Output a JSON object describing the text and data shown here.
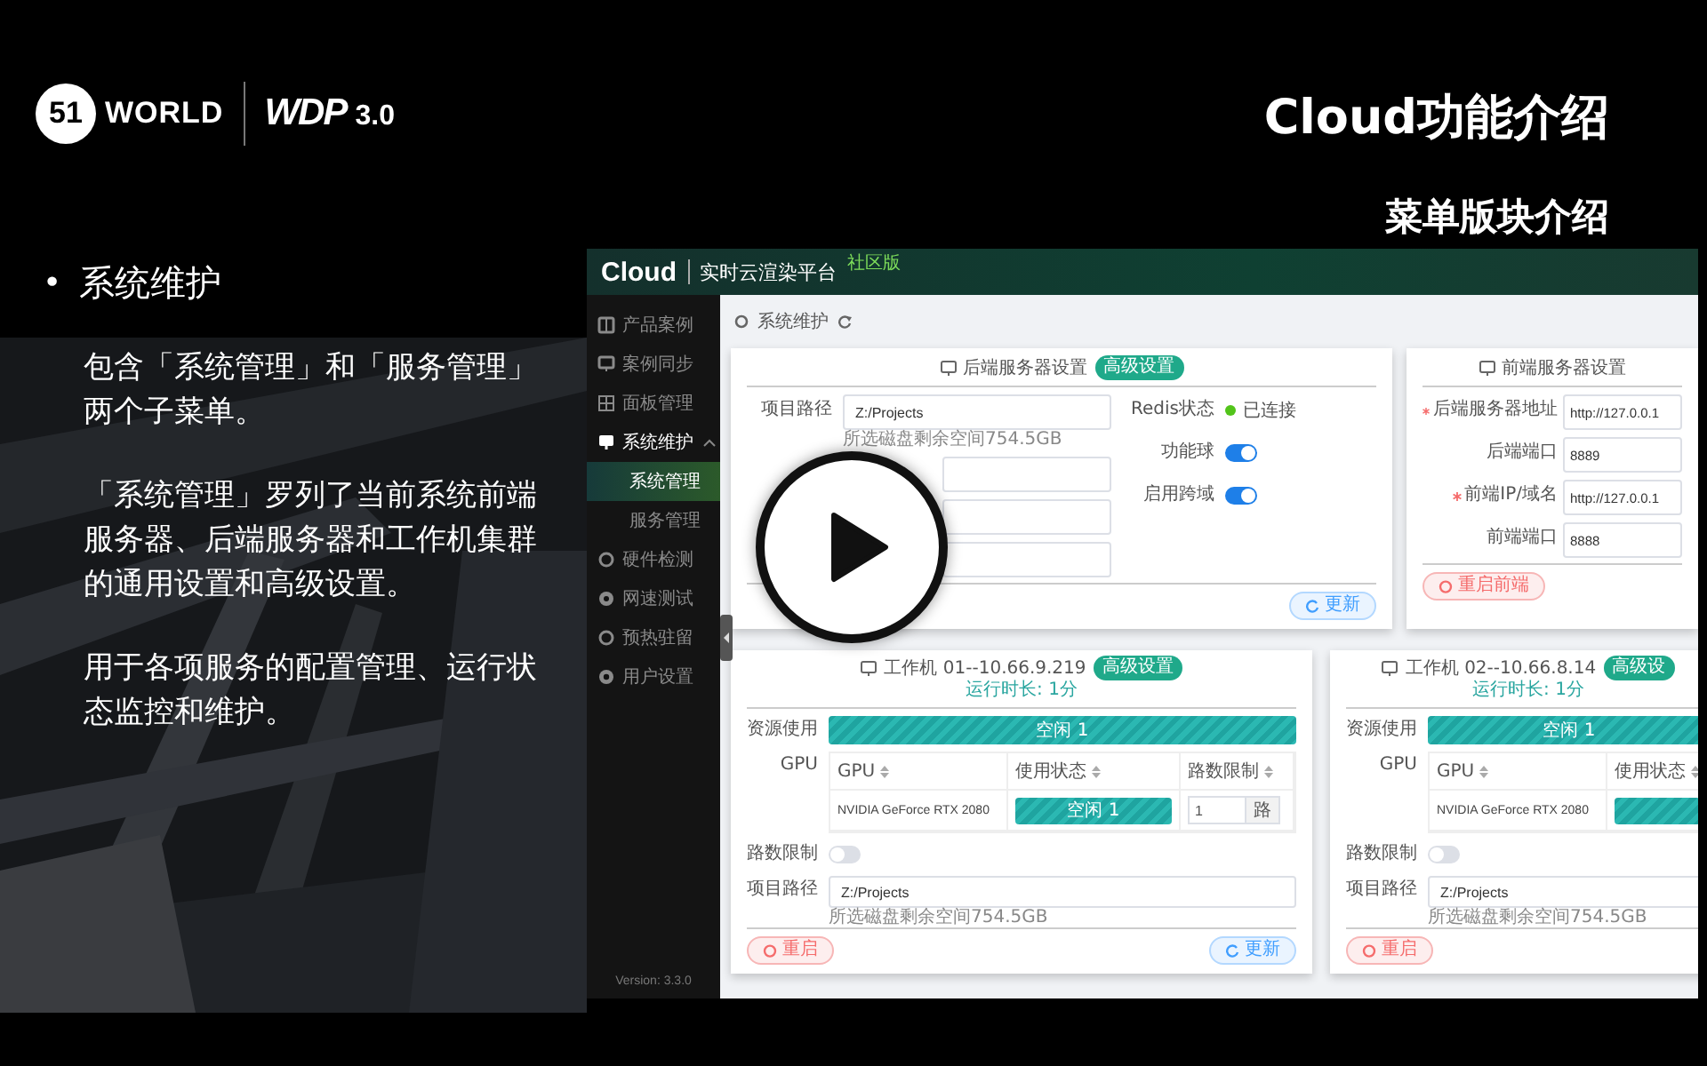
{
  "slide": {
    "logo": {
      "mark": "51",
      "word": "WORLD",
      "product": "WDP",
      "version": "3.0"
    },
    "title": "Cloud功能介绍",
    "subtitle": "菜单版块介绍",
    "bullet": {
      "marker": "•",
      "heading": "系统维护",
      "paragraphs": [
        "包含「系统管理」和「服务管理」两个子菜单。",
        "「系统管理」罗列了当前系统前端服务器、后端服务器和工作机集群的通用设置和高级设置。",
        "用于各项服务的配置管理、运行状态监控和维护。"
      ]
    }
  },
  "app": {
    "brand": "Cloud",
    "platform": "实时云渲染平台",
    "edition": "社区版",
    "sidebar": {
      "items": [
        {
          "label": "产品案例",
          "selected": false,
          "expanded": false
        },
        {
          "label": "案例同步",
          "selected": false,
          "expanded": false
        },
        {
          "label": "面板管理",
          "selected": false,
          "expanded": false
        },
        {
          "label": "系统维护",
          "selected": false,
          "expanded": true,
          "children": [
            {
              "label": "系统管理",
              "selected": true
            },
            {
              "label": "服务管理",
              "selected": false
            }
          ]
        },
        {
          "label": "硬件检测",
          "selected": false,
          "expanded": false
        },
        {
          "label": "网速测试",
          "selected": false,
          "expanded": false
        },
        {
          "label": "预热驻留",
          "selected": false,
          "expanded": false
        },
        {
          "label": "用户设置",
          "selected": false,
          "expanded": false
        }
      ],
      "version": "Version: 3.3.0"
    },
    "breadcrumb": "系统维护",
    "backend": {
      "title": "后端服务器设置",
      "badge": "高级设置",
      "left_rows": [
        {
          "kind": "field",
          "label": "项目路径",
          "value": "Z:/Projects",
          "hint": "所选磁盘剩余空间754.5GB"
        },
        {
          "kind": "field"
        },
        {
          "kind": "field"
        },
        {
          "kind": "field"
        }
      ],
      "right_rows": [
        {
          "kind": "status",
          "label": "Redis状态",
          "status": "已连接",
          "color": "#52c41a"
        },
        {
          "kind": "switch",
          "label": "功能球",
          "on": true
        },
        {
          "kind": "switch",
          "label": "启用跨域",
          "on": true
        }
      ],
      "buttons": [
        {
          "kind": "update",
          "label": "更新"
        }
      ]
    },
    "frontend": {
      "title": "前端服务器设置",
      "rows": [
        {
          "label": "后端服务器地址",
          "required": true,
          "value": "http://127.0.0.1"
        },
        {
          "label": "后端端口",
          "required": false,
          "value": "8889"
        },
        {
          "label": "前端IP/域名",
          "required": true,
          "value": "http://127.0.0.1"
        },
        {
          "label": "前端端口",
          "required": false,
          "value": "8888"
        }
      ],
      "buttons": [
        {
          "kind": "restart",
          "label": "重启前端"
        }
      ]
    },
    "workers": [
      {
        "title": "工作机 01--10.66.9.219",
        "badge": "高级设置",
        "uptime": "运行时长: 1分",
        "resource_label": "资源使用",
        "resource": "空闲 1",
        "gpu_label": "GPU",
        "columns": [
          "GPU",
          "使用状态",
          "路数限制"
        ],
        "gpus": [
          {
            "name": "NVIDIA GeForce RTX 2080",
            "status": "空闲 1",
            "limit": "1",
            "unit": "路"
          }
        ],
        "limit_label": "路数限制",
        "limit_on": false,
        "path_label": "项目路径",
        "path": "Z:/Projects",
        "hint": "所选磁盘剩余空间754.5GB",
        "buttons": [
          {
            "kind": "restart",
            "label": "重启"
          },
          {
            "kind": "update",
            "label": "更新"
          }
        ]
      },
      {
        "title": "工作机 02--10.66.8.14",
        "badge": "高级设",
        "uptime": "运行时长: 1分",
        "resource_label": "资源使用",
        "resource": "空闲 1",
        "gpu_label": "GPU",
        "columns": [
          "GPU",
          "使用状态"
        ],
        "gpus": [
          {
            "name": "NVIDIA GeForce RTX 2080"
          }
        ],
        "limit_label": "路数限制",
        "limit_on": false,
        "path_label": "项目路径",
        "path": "Z:/Projects",
        "hint": "所选磁盘剩余空间754.5GB",
        "buttons": [
          {
            "kind": "restart",
            "label": "重启"
          }
        ]
      }
    ]
  }
}
